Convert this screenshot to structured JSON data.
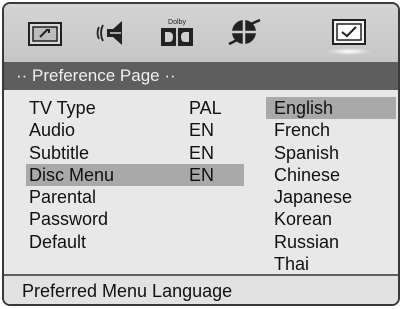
{
  "icon_bar": {
    "icons": [
      {
        "name": "general-setup-icon"
      },
      {
        "name": "audio-setup-icon"
      },
      {
        "name": "dolby-setup-icon",
        "label": "Dolby"
      },
      {
        "name": "video-setup-icon"
      },
      {
        "name": "preference-setup-icon",
        "selected": true
      }
    ]
  },
  "page_title": "·· Preference Page ··",
  "menu": {
    "items": [
      {
        "label": "TV Type",
        "value": "PAL"
      },
      {
        "label": "Audio",
        "value": "EN"
      },
      {
        "label": "Subtitle",
        "value": "EN"
      },
      {
        "label": "Disc Menu",
        "value": "EN",
        "highlighted": true
      },
      {
        "label": "Parental",
        "value": ""
      },
      {
        "label": "Password",
        "value": ""
      },
      {
        "label": "Default",
        "value": ""
      }
    ]
  },
  "languages": {
    "selected": "English",
    "options": [
      "English",
      "French",
      "Spanish",
      "Chinese",
      "Japanese",
      "Korean",
      "Russian",
      "Thai"
    ]
  },
  "status_text": "Preferred Menu Language",
  "colors": {
    "title_bar": "#5e5e5e",
    "highlight": "#a9a9a9",
    "background": "#e8e8e8"
  }
}
